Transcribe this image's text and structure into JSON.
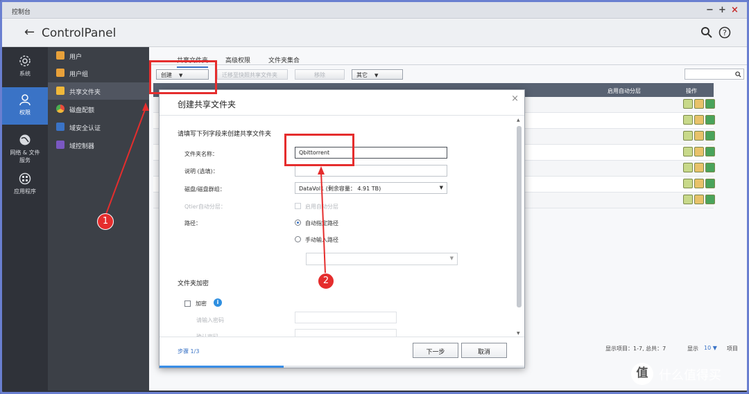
{
  "window": {
    "title": "控制台",
    "controls": [
      "−",
      "+",
      "×"
    ]
  },
  "header": {
    "back_icon": "arrow-left-icon",
    "title_prefix": "Control",
    "title_suffix": "Panel"
  },
  "leftnav": [
    {
      "label": "系统",
      "icon": "gear-icon"
    },
    {
      "label": "权限",
      "icon": "user-icon"
    },
    {
      "label": "网络 & 文件服务",
      "label_line1": "网络 & 文件",
      "label_line2": "服务",
      "icon": "globe-icon"
    },
    {
      "label": "应用程序",
      "icon": "apps-icon"
    }
  ],
  "subnav": [
    {
      "label": "用户",
      "color": "#e8a13a"
    },
    {
      "label": "用户组",
      "color": "#e8a13a"
    },
    {
      "label": "共享文件夹",
      "color": "#f0b83a"
    },
    {
      "label": "磁盘配额",
      "color": "#e84c3d"
    },
    {
      "label": "域安全认证",
      "color": "#3a73c6"
    },
    {
      "label": "域控制器",
      "color": "#7a58c2"
    }
  ],
  "tabs": [
    "共享文件夹",
    "高级权限",
    "文件夹集合"
  ],
  "toolbar": {
    "create": "创建",
    "move": "迁移至快照共享文件夹",
    "remove": "移除",
    "other": "其它"
  },
  "grid": {
    "header_col": "启用自动分层",
    "actions_col": "操作",
    "row_count": 7
  },
  "footer": {
    "display_items": "显示项目：1-7, 总共：7",
    "display": "显示",
    "per_page": "10",
    "unit": "项目"
  },
  "dialog": {
    "title": "创建共享文件夹",
    "intro": "请填写下列字段来创建共享文件夹",
    "folder_name_label": "文件夹名称：",
    "folder_name_value": "Qbittorrent",
    "comment_label": "说明 (选填)：",
    "disk_label": "磁盘/磁盘群组：",
    "disk_value": "DataVol1 (剩余容量： 4.91 TB)",
    "qtier_label": "Qtier自动分层：",
    "qtier_option": "启用自动分层",
    "path_label": "路径：",
    "path_auto": "自动指定路径",
    "path_manual": "手动输入路径",
    "encrypt_section": "文件夹加密",
    "encrypt_label": "加密",
    "encrypt_info_icon": "info-icon",
    "password_label": "请输入密码",
    "confirm_label": "确认密码",
    "steps": "步骤 1/3",
    "next": "下一步",
    "cancel": "取消",
    "progress": 0.34
  },
  "annotations": {
    "badge1": "1",
    "badge2": "2",
    "color": "#e52d2d"
  },
  "watermark": {
    "logo": "值",
    "text": "什么值得买"
  }
}
